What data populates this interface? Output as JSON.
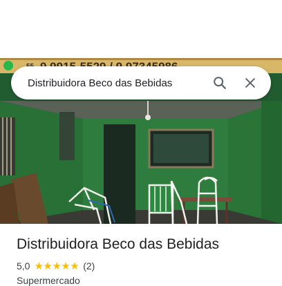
{
  "sign": {
    "prefix": "55",
    "phones": "9.9915-5529 / 9.97345986"
  },
  "search": {
    "query": "Distribuidora Beco das Bebidas"
  },
  "place": {
    "name": "Distribuidora Beco das Bebidas",
    "rating": "5,0",
    "stars": "★★★★★",
    "reviews": "(2)",
    "category": "Supermercado"
  },
  "colors": {
    "star": "#fbbc04",
    "wall_green": "#2e7d3a"
  }
}
